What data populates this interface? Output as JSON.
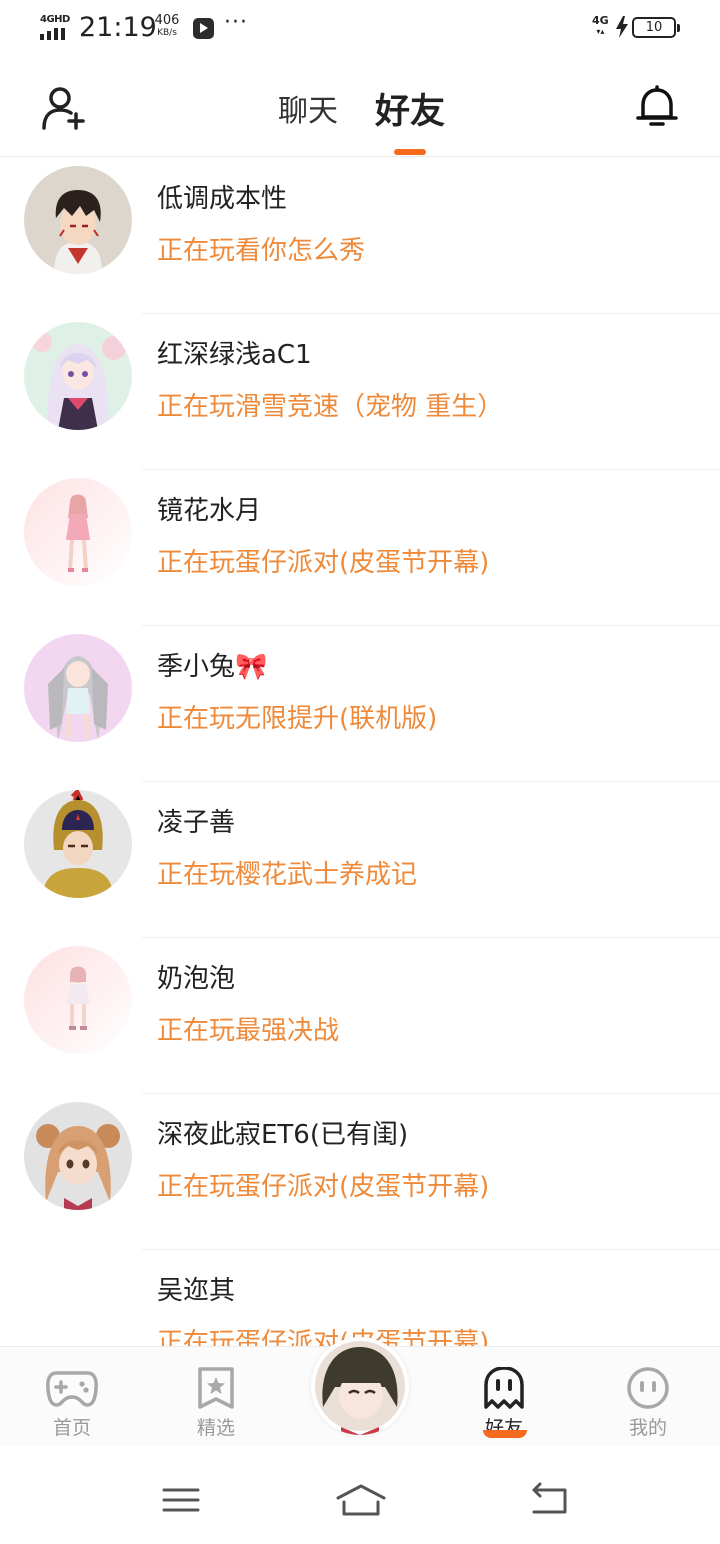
{
  "status_bar": {
    "network": "4GHD",
    "time": "21:19",
    "speed_value": "406",
    "speed_unit": "KB/s",
    "more": "···",
    "mobile": "4G",
    "battery": "10"
  },
  "header": {
    "tabs": [
      {
        "label": "聊天",
        "active": false
      },
      {
        "label": "好友",
        "active": true
      }
    ],
    "accent": "#f56a1c"
  },
  "friends": [
    {
      "name": "低调成本性",
      "status": "正在玩看你怎么秀",
      "avatar": "anime-boy-avatar"
    },
    {
      "name": "红深绿浅aC1",
      "status": "正在玩滑雪竞速（宠物 重生）",
      "avatar": "anime-girl-avatar"
    },
    {
      "name": "镜花水月",
      "status": "正在玩蛋仔派对(皮蛋节开幕)",
      "avatar": "pink-doll-avatar"
    },
    {
      "name": "季小兔🎀",
      "status": "正在玩无限提升(联机版)",
      "avatar": "silver-hair-girl-avatar"
    },
    {
      "name": "凌子善",
      "status": "正在玩樱花武士养成记",
      "avatar": "warrior-avatar"
    },
    {
      "name": "奶泡泡",
      "status": "正在玩最强决战",
      "avatar": "pink-doll-avatar"
    },
    {
      "name": "深夜此寂ET6(已有闺)",
      "status": "正在玩蛋仔派对(皮蛋节开幕)",
      "avatar": "bear-girl-avatar"
    },
    {
      "name": "吴迩其",
      "status": "正在玩蛋仔派对(皮蛋节开幕)",
      "avatar": ""
    }
  ],
  "bottom_nav": {
    "items": [
      {
        "label": "首页",
        "icon": "gamepad-icon",
        "active": false
      },
      {
        "label": "精选",
        "icon": "star-bookmark-icon",
        "active": false
      },
      {
        "label": "好友",
        "icon": "ghost-icon",
        "active": true
      },
      {
        "label": "我的",
        "icon": "smiley-icon",
        "active": false
      }
    ]
  },
  "colors": {
    "status_text": "#ee8a3a",
    "accent": "#f56a1c"
  }
}
